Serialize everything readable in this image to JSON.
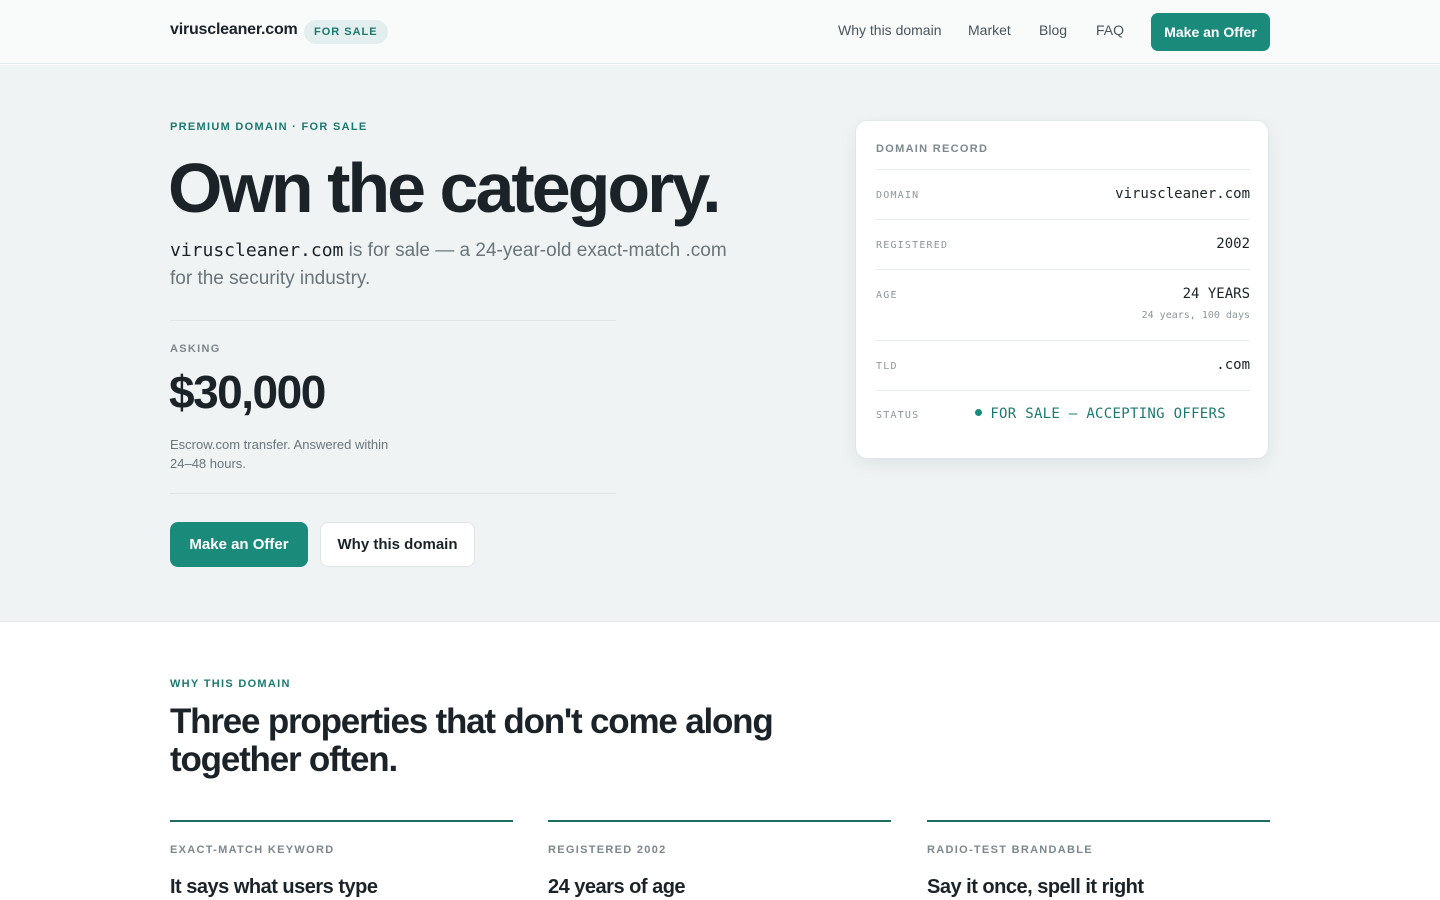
{
  "header": {
    "brand": "viruscleaner.com",
    "badge": "FOR SALE",
    "nav": [
      "Why this domain",
      "Market",
      "Blog",
      "FAQ"
    ],
    "cta": "Make an Offer"
  },
  "hero": {
    "eyebrow": "PREMIUM DOMAIN · FOR SALE",
    "title": "Own the category.",
    "lede_domain": "viruscleaner.com",
    "lede_rest": " is for sale — a 24-year-old exact-match .com for the security industry.",
    "asking_label": "ASKING",
    "price": "$30,000",
    "price_note": "Escrow.com transfer. Answered within 24–48 hours.",
    "primary_button": "Make an Offer",
    "secondary_button": "Why this domain"
  },
  "record": {
    "title": "DOMAIN RECORD",
    "rows": [
      {
        "key": "DOMAIN",
        "value": "viruscleaner.com"
      },
      {
        "key": "REGISTERED",
        "value": "2002"
      },
      {
        "key": "AGE",
        "value": "24 YEARS",
        "sub": "24 years, 100 days"
      },
      {
        "key": "TLD",
        "value": ".com"
      },
      {
        "key": "STATUS",
        "value": "FOR SALE — ACCEPTING OFFERS"
      }
    ]
  },
  "why": {
    "eyebrow": "WHY THIS DOMAIN",
    "title": "Three properties that don't come along together often.",
    "props": [
      {
        "label": "EXACT-MATCH KEYWORD",
        "head": "It says what users type"
      },
      {
        "label": "REGISTERED 2002",
        "head": "24 years of age"
      },
      {
        "label": "RADIO-TEST BRANDABLE",
        "head": "Say it once, spell it right"
      }
    ]
  },
  "colors": {
    "accent": "#1a8a7b",
    "hero_bg": "#eff3f4",
    "text": "#1b2328"
  }
}
